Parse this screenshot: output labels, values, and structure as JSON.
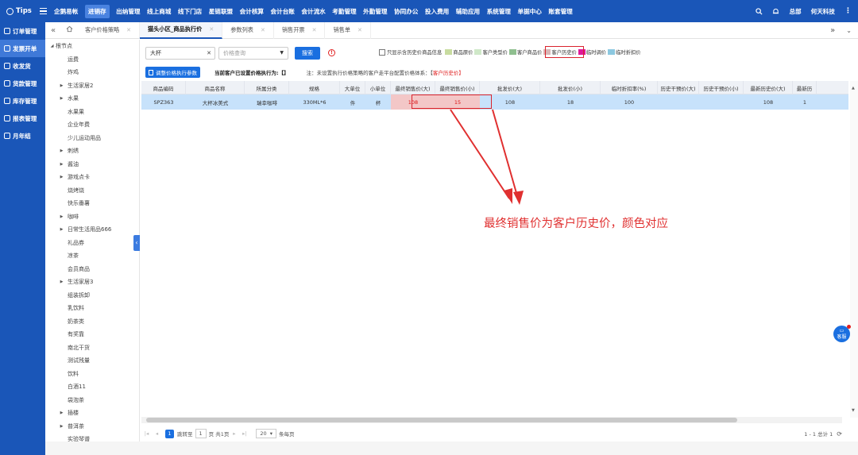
{
  "topbar": {
    "logo": "Tips",
    "nav": [
      "企鹅易帐",
      "进销存",
      "出纳管理",
      "线上商城",
      "线下门店",
      "星链联盟",
      "会计核算",
      "会计台账",
      "会计流水",
      "考勤管理",
      "外勤管理",
      "协同办公",
      "投入费用",
      "辅助应用",
      "系统管理",
      "单据中心",
      "账套管理"
    ],
    "active_index": 1,
    "right_items": [
      "总部",
      "何天科技"
    ]
  },
  "sidebar": {
    "items": [
      "订单管理",
      "发票开单",
      "收发货",
      "货款管理",
      "库存管理",
      "报表管理",
      "月年结"
    ],
    "active_index": 1
  },
  "tabs": {
    "items": [
      "客户价格策略",
      "猫头小区_商品执行价",
      "参数列表",
      "销售开票",
      "销售单"
    ],
    "active_index": 1
  },
  "tree": {
    "root": "根节点",
    "nodes": [
      {
        "label": "运费",
        "arrow": false
      },
      {
        "label": "炸鸡",
        "arrow": false
      },
      {
        "label": "生活家居2",
        "arrow": true
      },
      {
        "label": "水果",
        "arrow": true
      },
      {
        "label": "水果果",
        "arrow": false
      },
      {
        "label": "企业年费",
        "arrow": false
      },
      {
        "label": "少儿运动用品",
        "arrow": false
      },
      {
        "label": "刺绣",
        "arrow": true
      },
      {
        "label": "酱油",
        "arrow": true
      },
      {
        "label": "游戏点卡",
        "arrow": true
      },
      {
        "label": "烧烤烧",
        "arrow": false
      },
      {
        "label": "快乐番薯",
        "arrow": false
      },
      {
        "label": "咖啡",
        "arrow": true
      },
      {
        "label": "日常生活用品666",
        "arrow": true
      },
      {
        "label": "礼品券",
        "arrow": false
      },
      {
        "label": "凉茶",
        "arrow": false
      },
      {
        "label": "会员商品",
        "arrow": false
      },
      {
        "label": "生活家居3",
        "arrow": true
      },
      {
        "label": "组装拆卸",
        "arrow": false
      },
      {
        "label": "乳饮料",
        "arrow": false
      },
      {
        "label": "奶茶类",
        "arrow": false
      },
      {
        "label": "有奖靠",
        "arrow": false
      },
      {
        "label": "南北干货",
        "arrow": false
      },
      {
        "label": "测试残量",
        "arrow": false
      },
      {
        "label": "饮料",
        "arrow": false
      },
      {
        "label": "白酒11",
        "arrow": false
      },
      {
        "label": "袋泡茶",
        "arrow": false
      },
      {
        "label": "插楼",
        "arrow": true
      },
      {
        "label": "普洱茶",
        "arrow": true
      },
      {
        "label": "实验琴谱",
        "arrow": false
      }
    ]
  },
  "filter": {
    "keyword_value": "大杯",
    "price_placeholder": "价格查询",
    "search_label": "搜索",
    "info_symbol": "!"
  },
  "legend": {
    "checkbox_label": "只显示含历史价商品信息",
    "items": [
      {
        "label": "商品原价",
        "color": "#c8dca0"
      },
      {
        "label": "客户类型价",
        "color": "#cfe8c8"
      },
      {
        "label": "客户商品价",
        "color": "#8fbf8f"
      },
      {
        "label": "客户历史价",
        "color": "#d9b7b7"
      },
      {
        "label": "临时调价",
        "color": "#e0189a"
      },
      {
        "label": "临时折扣价",
        "color": "#8cc8e0"
      }
    ]
  },
  "actions": {
    "adjust_label": "调整价格执行参数",
    "current_rule": "当前客户已设置价格执行为:【】",
    "note_prefix": "注：未设置执行价格策略的客户走平台配置价格体系：【",
    "note_red": "客户历史价",
    "note_suffix": "】"
  },
  "table": {
    "columns": [
      "商品编码",
      "商品名称",
      "所属分类",
      "规格",
      "大单位",
      "小单位",
      "最终销售价(大)",
      "最终销售价(小)",
      "批发价(大)",
      "批发价(小)",
      "临时折扣率(%)",
      "历史干预价(大)",
      "历史干预价(小)",
      "最新历史价(大)",
      "最新历"
    ],
    "row": [
      "SPZ363",
      "大杯冰美式",
      "瑞幸咖啡",
      "330ML*6",
      "件",
      "杯",
      "108",
      "15",
      "108",
      "18",
      "100",
      "",
      "",
      "108",
      "1"
    ]
  },
  "pager": {
    "goto_label": "跳转至",
    "page_value": "1",
    "total_pages": "页 共1页",
    "page_size": "20",
    "per_page": "条每页",
    "summary": "1 - 1 总计 1",
    "current_page": "1"
  },
  "annotation": {
    "text": "最终销售价为客户历史价，颜色对应"
  },
  "float": {
    "label": "客服"
  }
}
